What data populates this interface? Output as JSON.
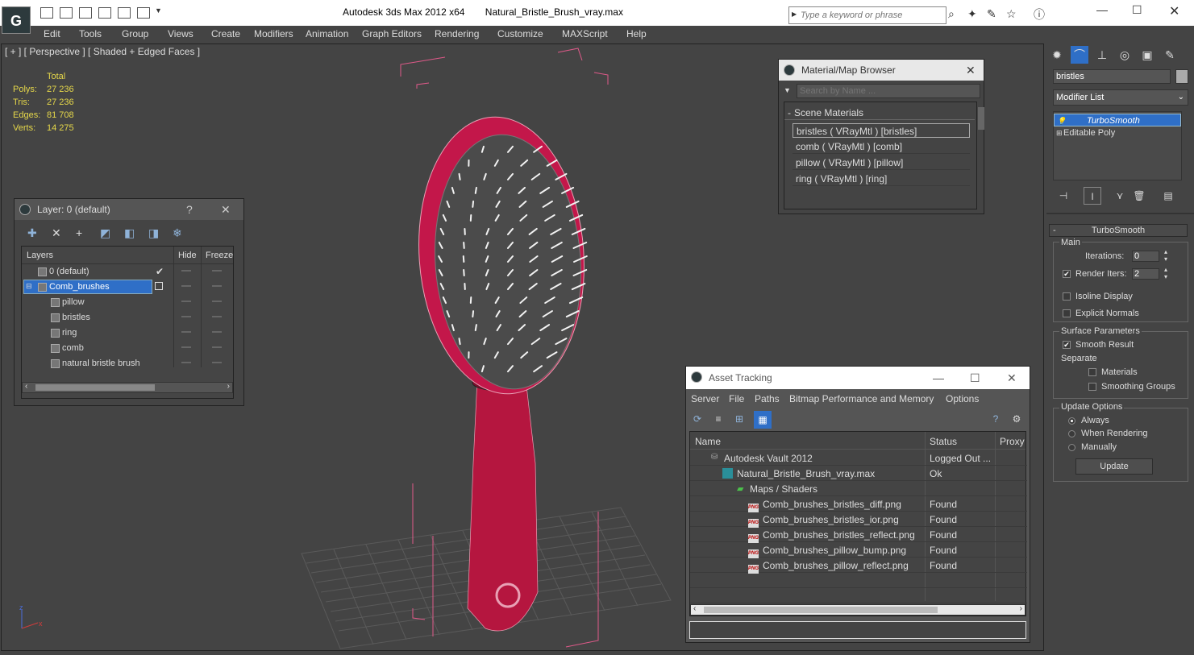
{
  "window": {
    "app_title": "Autodesk 3ds Max  2012 x64",
    "file_name": "Natural_Bristle_Brush_vray.max",
    "logo_glyph": "G",
    "search_placeholder": "Type a keyword or phrase"
  },
  "menu": [
    "Edit",
    "Tools",
    "Group",
    "Views",
    "Create",
    "Modifiers",
    "Animation",
    "Graph Editors",
    "Rendering",
    "Customize",
    "MAXScript",
    "Help"
  ],
  "viewport": {
    "label": "[ + ] [ Perspective ] [ Shaded + Edged Faces ]",
    "stats": {
      "header": "Total",
      "rows": [
        {
          "key": "Polys:",
          "value": "27 236"
        },
        {
          "key": "Tris:",
          "value": "27 236"
        },
        {
          "key": "Edges:",
          "value": "81 708"
        },
        {
          "key": "Verts:",
          "value": "14 275"
        }
      ]
    },
    "axis_labels": {
      "z": "z",
      "x": "x"
    }
  },
  "layer_panel": {
    "title": "Layer: 0 (default)",
    "help": "?",
    "columns": {
      "layers": "Layers",
      "hide": "Hide",
      "freeze": "Freeze"
    },
    "rows": [
      {
        "label": "0 (default)",
        "indent": 0,
        "active": true
      },
      {
        "label": "Comb_brushes",
        "indent": 0,
        "selected": true
      },
      {
        "label": "pillow",
        "indent": 1
      },
      {
        "label": "bristles",
        "indent": 1
      },
      {
        "label": "ring",
        "indent": 1
      },
      {
        "label": "comb",
        "indent": 1
      },
      {
        "label": "natural bristle brush",
        "indent": 1
      }
    ]
  },
  "material_browser": {
    "title": "Material/Map Browser",
    "search_placeholder": "Search by Name ...",
    "group_label": "Scene Materials",
    "items": [
      "bristles  ( VRayMtl ) [bristles]",
      "comb  ( VRayMtl ) [comb]",
      "pillow  ( VRayMtl ) [pillow]",
      "ring  ( VRayMtl ) [ring]"
    ]
  },
  "asset_tracking": {
    "title": "Asset Tracking",
    "menu": [
      "Server",
      "File",
      "Paths",
      "Bitmap Performance and Memory",
      "Options"
    ],
    "columns": {
      "name": "Name",
      "status": "Status",
      "proxy": "Proxy"
    },
    "rows": [
      {
        "name": "Autodesk Vault 2012",
        "status": "Logged Out ...",
        "level": 1,
        "icon": "vault"
      },
      {
        "name": "Natural_Bristle_Brush_vray.max",
        "status": "Ok",
        "level": 2,
        "icon": "max"
      },
      {
        "name": "Maps / Shaders",
        "status": "",
        "level": 3,
        "icon": "maps"
      },
      {
        "name": "Comb_brushes_bristles_diff.png",
        "status": "Found",
        "level": 4,
        "icon": "png"
      },
      {
        "name": "Comb_brushes_bristles_ior.png",
        "status": "Found",
        "level": 4,
        "icon": "png"
      },
      {
        "name": "Comb_brushes_bristles_reflect.png",
        "status": "Found",
        "level": 4,
        "icon": "png"
      },
      {
        "name": "Comb_brushes_pillow_bump.png",
        "status": "Found",
        "level": 4,
        "icon": "png"
      },
      {
        "name": "Comb_brushes_pillow_reflect.png",
        "status": "Found",
        "level": 4,
        "icon": "png"
      }
    ]
  },
  "command_panel": {
    "object_name": "bristles",
    "modifier_list": "Modifier List",
    "stack": [
      "TurboSmooth",
      "Editable Poly"
    ],
    "rollout_title": "TurboSmooth",
    "main_label": "Main",
    "iterations_label": "Iterations:",
    "iterations_value": "0",
    "render_iters_label": "Render Iters:",
    "render_iters_value": "2",
    "render_iters_checked": true,
    "isoline_label": "Isoline Display",
    "explicit_normals_label": "Explicit Normals",
    "surface_params_label": "Surface Parameters",
    "smooth_result_label": "Smooth Result",
    "smooth_result_checked": true,
    "separate_label": "Separate",
    "materials_label": "Materials",
    "smoothing_groups_label": "Smoothing Groups",
    "update_options_label": "Update Options",
    "update_options": [
      "Always",
      "When Rendering",
      "Manually"
    ],
    "update_selected": "Always",
    "update_button": "Update"
  }
}
